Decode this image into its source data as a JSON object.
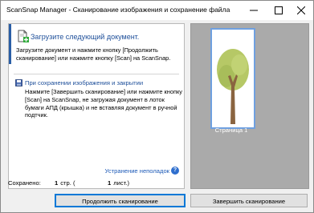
{
  "window": {
    "title": "ScanSnap Manager - Сканирование изображения и сохранение файла",
    "controls": [
      "minimize-icon",
      "maximize-icon",
      "close-icon"
    ]
  },
  "instruction": {
    "heading": "Загрузите следующий документ.",
    "message": "Загрузите документ и нажмите кнопку [Продолжить сканирование] или нажмите кнопку [Scan] на ScanSnap."
  },
  "save_info": {
    "title": "При сохранении изображения и закрытии",
    "body": "Нажмите [Завершить сканирование] или нажмите кнопку [Scan] на ScanSnap, не загружая документ в лоток бумаги АПД (крышка) и не вставляя документ в ручной подтчик."
  },
  "troubleshoot_link": "Устранение неполадок",
  "saved": {
    "label": "Сохранено:",
    "pages_value": "1",
    "pages_unit": "стр. (",
    "sheets_value": "1",
    "sheets_unit": "лист.)"
  },
  "preview": {
    "caption": "Страница 1"
  },
  "buttons": {
    "continue": "Продолжить сканирование",
    "finish": "Завершить сканирование"
  },
  "colors": {
    "accent": "#2a5ea6",
    "link": "#1e5bb8",
    "preview_bg": "#aaaaaa",
    "thumb_border": "#6fa0e0"
  }
}
